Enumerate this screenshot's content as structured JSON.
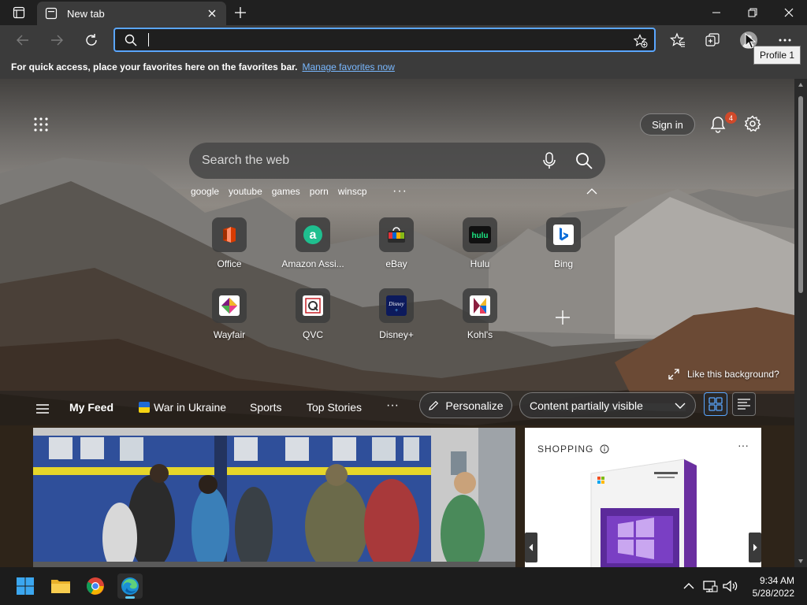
{
  "browser": {
    "tab_title": "New tab",
    "address_value": "",
    "tooltip": "Profile 1",
    "favbar_text": "For quick access, place your favorites here on the favorites bar.",
    "favbar_link": "Manage favorites now"
  },
  "newtab": {
    "sign_in": "Sign in",
    "notification_count": "4",
    "search_placeholder": "Search the web",
    "quick_searches": [
      "google",
      "youtube",
      "games",
      "porn",
      "winscp"
    ],
    "more": "···",
    "tiles": [
      {
        "label": "Office",
        "icon": "office-icon"
      },
      {
        "label": "Amazon Assi...",
        "icon": "amazon-icon"
      },
      {
        "label": "eBay",
        "icon": "ebay-icon"
      },
      {
        "label": "Hulu",
        "icon": "hulu-icon"
      },
      {
        "label": "Bing",
        "icon": "bing-icon"
      },
      {
        "label": "Wayfair",
        "icon": "wayfair-icon"
      },
      {
        "label": "QVC",
        "icon": "qvc-icon"
      },
      {
        "label": "Disney+",
        "icon": "disney-icon"
      },
      {
        "label": "Kohl's",
        "icon": "kohls-icon"
      }
    ],
    "like_background": "Like this background?"
  },
  "feed": {
    "tabs": [
      "My Feed",
      "War in Ukraine",
      "Sports",
      "Top Stories"
    ],
    "more": "···",
    "personalize": "Personalize",
    "visibility": "Content partially visible",
    "shopping_title": "SHOPPING",
    "shopping_more": "···"
  },
  "taskbar": {
    "time": "9:34 AM",
    "date": "5/28/2022"
  },
  "colors": {
    "accent": "#5aa6ff",
    "badge": "#d0492a",
    "taskbar": "#1c1c1c"
  }
}
